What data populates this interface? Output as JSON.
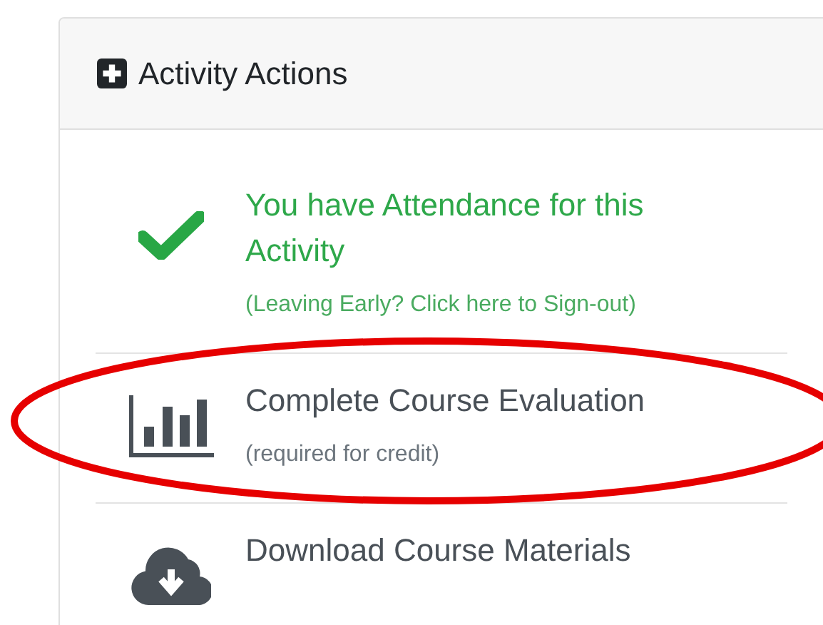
{
  "card": {
    "title": "Activity Actions"
  },
  "items": [
    {
      "kind": "status",
      "title": "You have Attendance for this Activity",
      "subtitle": "(Leaving Early? Click here to Sign-out)"
    },
    {
      "kind": "action",
      "title": "Complete Course Evaluation",
      "subtitle": "(required for credit)"
    },
    {
      "kind": "action",
      "title": "Download Course Materials"
    }
  ],
  "annotation": {
    "kind": "ellipse",
    "color": "#e60000"
  }
}
